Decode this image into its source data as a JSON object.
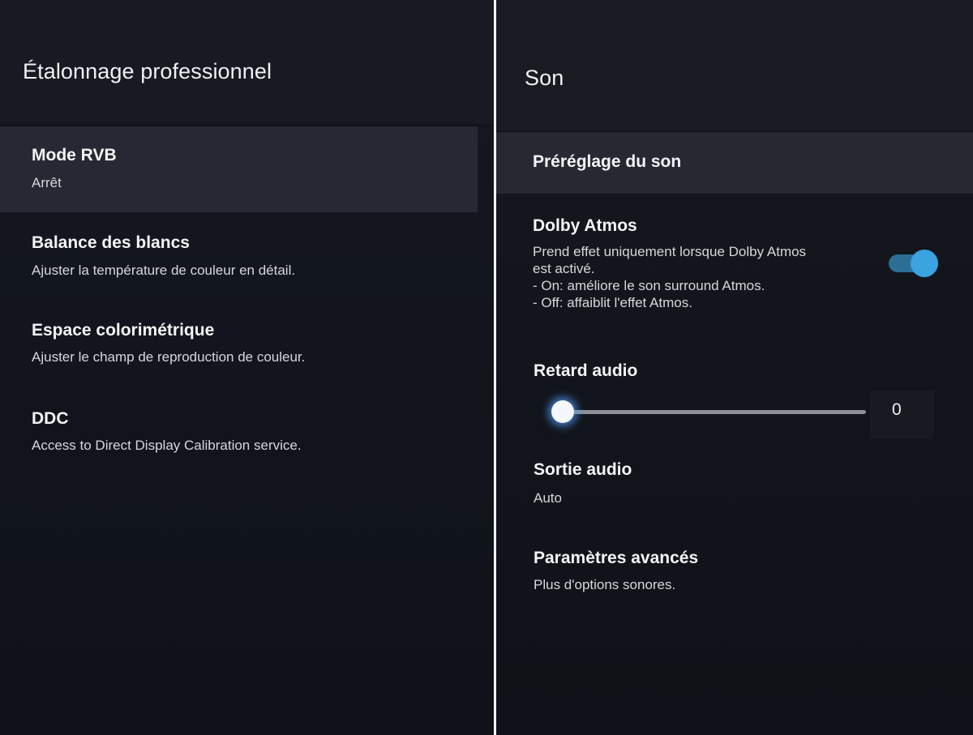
{
  "left_panel": {
    "title": "Étalonnage professionnel",
    "items": [
      {
        "title": "Mode RVB",
        "subtitle": "Arrêt",
        "focused": true
      },
      {
        "title": "Balance des blancs",
        "subtitle": "Ajuster la température de couleur en détail."
      },
      {
        "title": "Espace colorimétrique",
        "subtitle": "Ajuster le champ de reproduction de couleur."
      },
      {
        "title": "DDC",
        "subtitle": "Access to Direct Display Calibration service."
      }
    ]
  },
  "right_panel": {
    "title": "Son",
    "items": {
      "sound_preset": {
        "title": "Préréglage du son",
        "focused": true
      },
      "dolby_atmos": {
        "title": "Dolby Atmos",
        "description_lines": [
          "Prend effet uniquement lorsque Dolby Atmos",
          "est activé.",
          "- On: améliore le son surround Atmos.",
          "- Off: affaiblit l'effet Atmos."
        ],
        "toggle_on": true,
        "toggle_color": "#3aa3e0"
      },
      "audio_delay": {
        "title": "Retard audio",
        "value": "0",
        "slider_fraction": 0
      },
      "audio_output": {
        "title": "Sortie audio",
        "subtitle": "Auto"
      },
      "advanced": {
        "title": "Paramètres avancés",
        "subtitle": "Plus d'options sonores."
      }
    }
  },
  "colors": {
    "background": "#12151d",
    "focus_highlight": "#262933",
    "accent_blue": "#3aa3e0",
    "divider": "#f4f4f4"
  }
}
